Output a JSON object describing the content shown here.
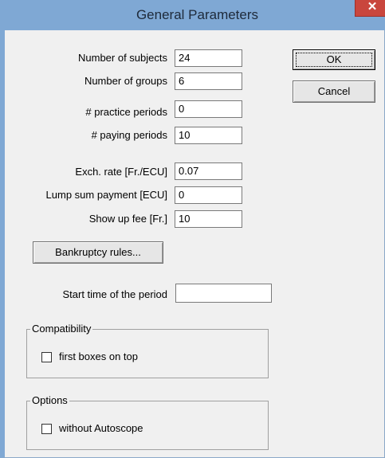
{
  "window": {
    "title": "General Parameters",
    "close_glyph": "✕"
  },
  "fields": [
    {
      "label": "Number of subjects",
      "value": "24"
    },
    {
      "label": "Number of groups",
      "value": "6"
    },
    {
      "label": "# practice periods",
      "value": "0"
    },
    {
      "label": "# paying periods",
      "value": "10"
    },
    {
      "label": "Exch. rate [Fr./ECU]",
      "value": "0.07"
    },
    {
      "label": "Lump sum payment [ECU]",
      "value": "0"
    },
    {
      "label": "Show up fee [Fr.]",
      "value": "10"
    }
  ],
  "buttons": {
    "ok": "OK",
    "cancel": "Cancel",
    "bankruptcy": "Bankruptcy rules..."
  },
  "start_time": {
    "label": "Start time of the period",
    "value": ""
  },
  "compatibility": {
    "title": "Compatibility",
    "checkbox_label": "first boxes on top",
    "checked": false
  },
  "options": {
    "title": "Options",
    "checkbox_label": "without Autoscope",
    "checked": false
  },
  "colors": {
    "titlebar": "#7fa8d4",
    "close": "#c9463d",
    "client": "#f0f0f0"
  }
}
